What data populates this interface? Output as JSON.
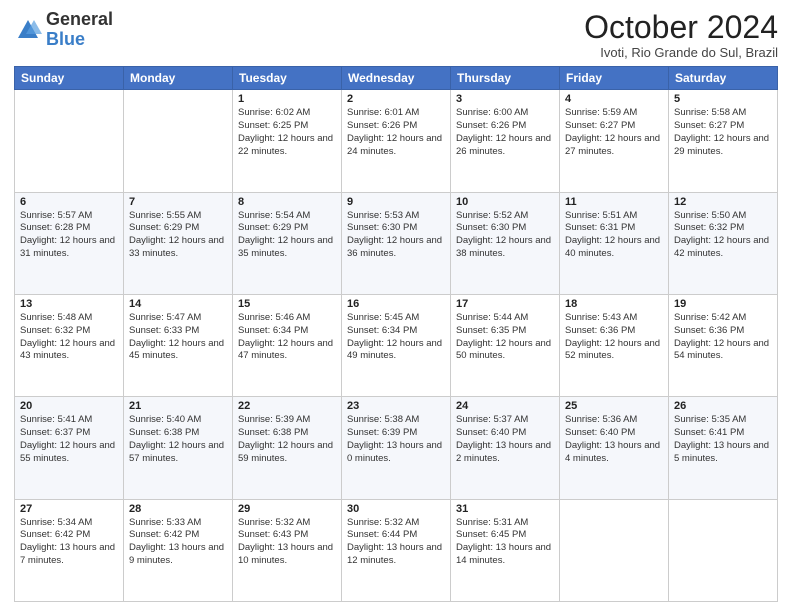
{
  "header": {
    "logo_general": "General",
    "logo_blue": "Blue",
    "main_title": "October 2024",
    "subtitle": "Ivoti, Rio Grande do Sul, Brazil"
  },
  "days_of_week": [
    "Sunday",
    "Monday",
    "Tuesday",
    "Wednesday",
    "Thursday",
    "Friday",
    "Saturday"
  ],
  "weeks": [
    [
      {
        "day": null
      },
      {
        "day": null
      },
      {
        "day": "1",
        "sunrise": "Sunrise: 6:02 AM",
        "sunset": "Sunset: 6:25 PM",
        "daylight": "Daylight: 12 hours and 22 minutes."
      },
      {
        "day": "2",
        "sunrise": "Sunrise: 6:01 AM",
        "sunset": "Sunset: 6:26 PM",
        "daylight": "Daylight: 12 hours and 24 minutes."
      },
      {
        "day": "3",
        "sunrise": "Sunrise: 6:00 AM",
        "sunset": "Sunset: 6:26 PM",
        "daylight": "Daylight: 12 hours and 26 minutes."
      },
      {
        "day": "4",
        "sunrise": "Sunrise: 5:59 AM",
        "sunset": "Sunset: 6:27 PM",
        "daylight": "Daylight: 12 hours and 27 minutes."
      },
      {
        "day": "5",
        "sunrise": "Sunrise: 5:58 AM",
        "sunset": "Sunset: 6:27 PM",
        "daylight": "Daylight: 12 hours and 29 minutes."
      }
    ],
    [
      {
        "day": "6",
        "sunrise": "Sunrise: 5:57 AM",
        "sunset": "Sunset: 6:28 PM",
        "daylight": "Daylight: 12 hours and 31 minutes."
      },
      {
        "day": "7",
        "sunrise": "Sunrise: 5:55 AM",
        "sunset": "Sunset: 6:29 PM",
        "daylight": "Daylight: 12 hours and 33 minutes."
      },
      {
        "day": "8",
        "sunrise": "Sunrise: 5:54 AM",
        "sunset": "Sunset: 6:29 PM",
        "daylight": "Daylight: 12 hours and 35 minutes."
      },
      {
        "day": "9",
        "sunrise": "Sunrise: 5:53 AM",
        "sunset": "Sunset: 6:30 PM",
        "daylight": "Daylight: 12 hours and 36 minutes."
      },
      {
        "day": "10",
        "sunrise": "Sunrise: 5:52 AM",
        "sunset": "Sunset: 6:30 PM",
        "daylight": "Daylight: 12 hours and 38 minutes."
      },
      {
        "day": "11",
        "sunrise": "Sunrise: 5:51 AM",
        "sunset": "Sunset: 6:31 PM",
        "daylight": "Daylight: 12 hours and 40 minutes."
      },
      {
        "day": "12",
        "sunrise": "Sunrise: 5:50 AM",
        "sunset": "Sunset: 6:32 PM",
        "daylight": "Daylight: 12 hours and 42 minutes."
      }
    ],
    [
      {
        "day": "13",
        "sunrise": "Sunrise: 5:48 AM",
        "sunset": "Sunset: 6:32 PM",
        "daylight": "Daylight: 12 hours and 43 minutes."
      },
      {
        "day": "14",
        "sunrise": "Sunrise: 5:47 AM",
        "sunset": "Sunset: 6:33 PM",
        "daylight": "Daylight: 12 hours and 45 minutes."
      },
      {
        "day": "15",
        "sunrise": "Sunrise: 5:46 AM",
        "sunset": "Sunset: 6:34 PM",
        "daylight": "Daylight: 12 hours and 47 minutes."
      },
      {
        "day": "16",
        "sunrise": "Sunrise: 5:45 AM",
        "sunset": "Sunset: 6:34 PM",
        "daylight": "Daylight: 12 hours and 49 minutes."
      },
      {
        "day": "17",
        "sunrise": "Sunrise: 5:44 AM",
        "sunset": "Sunset: 6:35 PM",
        "daylight": "Daylight: 12 hours and 50 minutes."
      },
      {
        "day": "18",
        "sunrise": "Sunrise: 5:43 AM",
        "sunset": "Sunset: 6:36 PM",
        "daylight": "Daylight: 12 hours and 52 minutes."
      },
      {
        "day": "19",
        "sunrise": "Sunrise: 5:42 AM",
        "sunset": "Sunset: 6:36 PM",
        "daylight": "Daylight: 12 hours and 54 minutes."
      }
    ],
    [
      {
        "day": "20",
        "sunrise": "Sunrise: 5:41 AM",
        "sunset": "Sunset: 6:37 PM",
        "daylight": "Daylight: 12 hours and 55 minutes."
      },
      {
        "day": "21",
        "sunrise": "Sunrise: 5:40 AM",
        "sunset": "Sunset: 6:38 PM",
        "daylight": "Daylight: 12 hours and 57 minutes."
      },
      {
        "day": "22",
        "sunrise": "Sunrise: 5:39 AM",
        "sunset": "Sunset: 6:38 PM",
        "daylight": "Daylight: 12 hours and 59 minutes."
      },
      {
        "day": "23",
        "sunrise": "Sunrise: 5:38 AM",
        "sunset": "Sunset: 6:39 PM",
        "daylight": "Daylight: 13 hours and 0 minutes."
      },
      {
        "day": "24",
        "sunrise": "Sunrise: 5:37 AM",
        "sunset": "Sunset: 6:40 PM",
        "daylight": "Daylight: 13 hours and 2 minutes."
      },
      {
        "day": "25",
        "sunrise": "Sunrise: 5:36 AM",
        "sunset": "Sunset: 6:40 PM",
        "daylight": "Daylight: 13 hours and 4 minutes."
      },
      {
        "day": "26",
        "sunrise": "Sunrise: 5:35 AM",
        "sunset": "Sunset: 6:41 PM",
        "daylight": "Daylight: 13 hours and 5 minutes."
      }
    ],
    [
      {
        "day": "27",
        "sunrise": "Sunrise: 5:34 AM",
        "sunset": "Sunset: 6:42 PM",
        "daylight": "Daylight: 13 hours and 7 minutes."
      },
      {
        "day": "28",
        "sunrise": "Sunrise: 5:33 AM",
        "sunset": "Sunset: 6:42 PM",
        "daylight": "Daylight: 13 hours and 9 minutes."
      },
      {
        "day": "29",
        "sunrise": "Sunrise: 5:32 AM",
        "sunset": "Sunset: 6:43 PM",
        "daylight": "Daylight: 13 hours and 10 minutes."
      },
      {
        "day": "30",
        "sunrise": "Sunrise: 5:32 AM",
        "sunset": "Sunset: 6:44 PM",
        "daylight": "Daylight: 13 hours and 12 minutes."
      },
      {
        "day": "31",
        "sunrise": "Sunrise: 5:31 AM",
        "sunset": "Sunset: 6:45 PM",
        "daylight": "Daylight: 13 hours and 14 minutes."
      },
      {
        "day": null
      },
      {
        "day": null
      }
    ]
  ]
}
